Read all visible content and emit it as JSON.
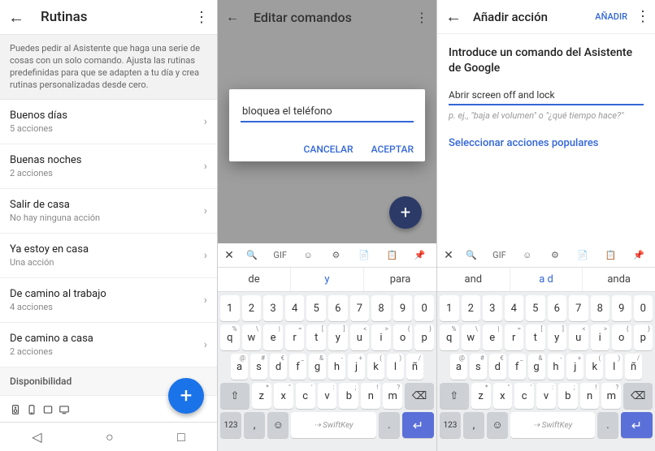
{
  "panel1": {
    "title": "Rutinas",
    "description": "Puedes pedir al Asistente que haga una serie de cosas con un solo comando. Ajusta las rutinas predefinidas para que se adapten a tu día y crea rutinas personalizadas desde cero.",
    "items": [
      {
        "title": "Buenos días",
        "sub": "5 acciones"
      },
      {
        "title": "Buenas noches",
        "sub": "2 acciones"
      },
      {
        "title": "Salir de casa",
        "sub": "No hay ninguna acción"
      },
      {
        "title": "Ya estoy en casa",
        "sub": "Una acción"
      },
      {
        "title": "De camino al trabajo",
        "sub": "4 acciones"
      },
      {
        "title": "De camino a casa",
        "sub": "2 acciones"
      }
    ],
    "section": "Disponibilidad"
  },
  "panel2": {
    "title": "Editar comandos",
    "input_value": "bloquea el teléfono",
    "cancel": "CANCELAR",
    "accept": "ACEPTAR"
  },
  "panel3": {
    "title": "Añadir acción",
    "add": "AÑADIR",
    "heading": "Introduce un comando del Asistente de Google",
    "input_value": "Abrir screen off and lock",
    "hint": "p. ej., \"baja el volumen\" o \"¿qué tiempo hace?\"",
    "link": "Seleccionar acciones populares"
  },
  "keyboardA": {
    "suggestions": [
      "de",
      "y",
      "para"
    ],
    "row1": [
      "1",
      "2",
      "3",
      "4",
      "5",
      "6",
      "7",
      "8",
      "9",
      "0"
    ],
    "row2": [
      "q",
      "w",
      "e",
      "r",
      "t",
      "y",
      "u",
      "i",
      "o",
      "p"
    ],
    "row3": [
      "a",
      "s",
      "d",
      "f",
      "g",
      "h",
      "j",
      "k",
      "l",
      "ñ"
    ],
    "row4": [
      "z",
      "x",
      "c",
      "v",
      "b",
      "n",
      "m"
    ],
    "sym": "123",
    "space": "SwiftKey"
  },
  "keyboardB": {
    "suggestions": [
      "and",
      "a d",
      "anda"
    ],
    "row1": [
      "1",
      "2",
      "3",
      "4",
      "5",
      "6",
      "7",
      "8",
      "9",
      "0"
    ],
    "row2": [
      "q",
      "w",
      "e",
      "r",
      "t",
      "y",
      "u",
      "i",
      "o",
      "p"
    ],
    "row3": [
      "a",
      "s",
      "d",
      "f",
      "g",
      "h",
      "j",
      "k",
      "l",
      "ñ"
    ],
    "row4": [
      "z",
      "x",
      "c",
      "v",
      "b",
      "n",
      "m"
    ],
    "sym": "123",
    "space": "SwiftKey"
  }
}
